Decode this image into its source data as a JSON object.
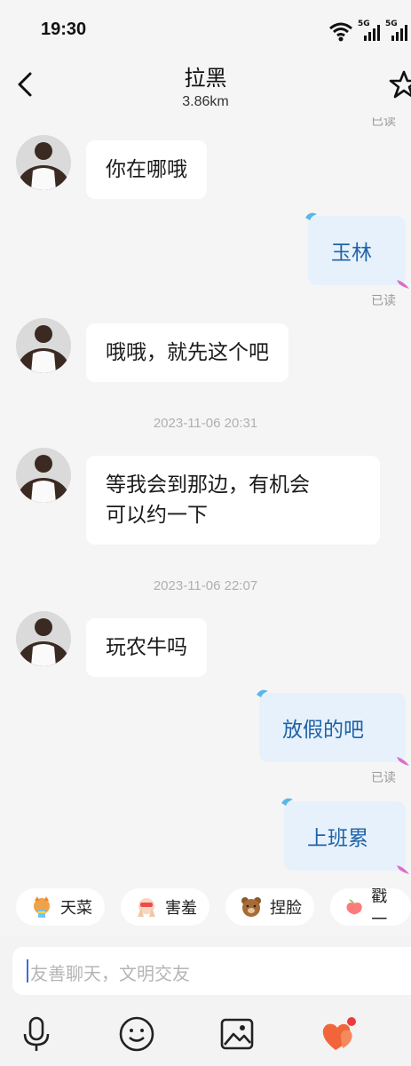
{
  "status_bar": {
    "time": "19:30",
    "network_label_1": "5G",
    "network_label_2": "5G"
  },
  "header": {
    "title": "拉黑",
    "distance": "3.86km"
  },
  "messages": {
    "read_top": "已读",
    "m1": "你在哪哦",
    "m2": "玉林",
    "m2_status": "已读",
    "m3": "哦哦，就先这个吧",
    "ts1": "2023-11-06 20:31",
    "m4_line1": "等我会到那边，有机会",
    "m4_line2": "可以约一下",
    "ts2": "2023-11-06 22:07",
    "m5": "玩农牛吗",
    "m6": "放假的吧",
    "m6_status": "已读",
    "m7": "上班累"
  },
  "quick_replies": [
    {
      "label": "天菜",
      "icon": "corgi-rainbow-icon"
    },
    {
      "label": "害羞",
      "icon": "shy-hands-icon"
    },
    {
      "label": "捏脸",
      "icon": "bear-icon"
    },
    {
      "label": "戳一",
      "icon": "peach-icon"
    }
  ],
  "input": {
    "placeholder": "友善聊天，文明交友"
  },
  "toolbar": [
    "microphone-icon",
    "emoji-icon",
    "image-icon",
    "hearts-icon"
  ],
  "colors": {
    "outgoing_bubble": "#e7f1fc",
    "outgoing_text": "#1f63a8",
    "accent": "#f2653a"
  }
}
